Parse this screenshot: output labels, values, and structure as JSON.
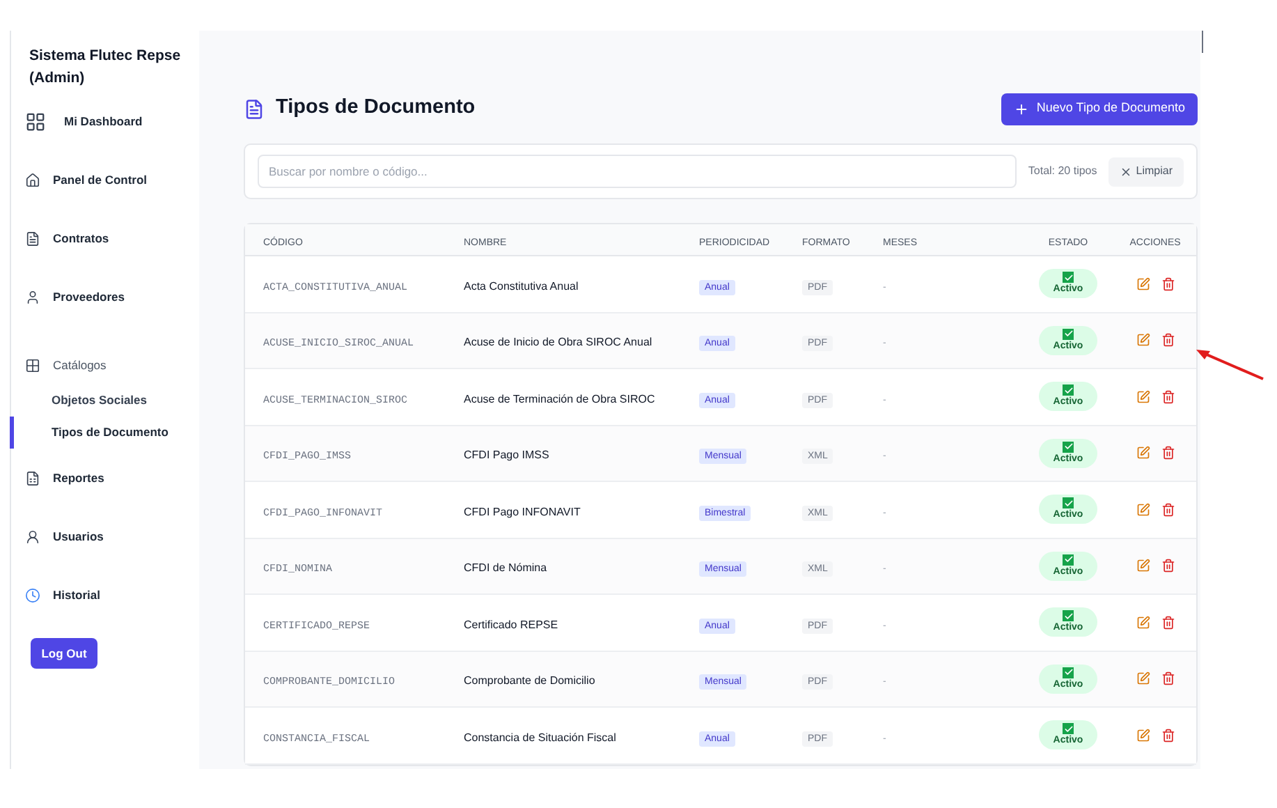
{
  "sidebar": {
    "title": "Sistema Flutec Repse (Admin)",
    "items": [
      {
        "label": "Mi Dashboard",
        "kind": "item",
        "selected": false
      },
      {
        "label": "Panel de Control",
        "kind": "item",
        "selected": false
      },
      {
        "label": "Contratos",
        "kind": "item",
        "selected": false
      },
      {
        "label": "Proveedores",
        "kind": "item",
        "selected": false
      },
      {
        "label": "Catálogos",
        "kind": "group",
        "selected": false
      },
      {
        "label": "Objetos Sociales",
        "kind": "subitem",
        "selected": false
      },
      {
        "label": "Tipos de Documento",
        "kind": "subitem",
        "selected": true
      },
      {
        "label": "Reportes",
        "kind": "item",
        "selected": false
      },
      {
        "label": "Usuarios",
        "kind": "item",
        "selected": false
      },
      {
        "label": "Historial",
        "kind": "item",
        "selected": false
      }
    ],
    "logout": "Log Out"
  },
  "page": {
    "title": "Tipos de Documento",
    "new_button": "Nuevo Tipo de Documento"
  },
  "search": {
    "placeholder": "Buscar por nombre o código...",
    "total": "Total: 20 tipos",
    "clear": "Limpiar"
  },
  "table": {
    "columns": [
      "CÓDIGO",
      "NOMBRE",
      "PERIODICIDAD",
      "FORMATO",
      "MESES",
      "ESTADO",
      "ACCIONES"
    ],
    "rows": [
      {
        "code": "ACTA_CONSTITUTIVA_ANUAL",
        "name": "Acta Constitutiva Anual",
        "period": "Anual",
        "format": "PDF",
        "months": "-",
        "status": "Activo",
        "active": true
      },
      {
        "code": "ACUSE_INICIO_SIROC_ANUAL",
        "name": "Acuse de Inicio de Obra SIROC Anual",
        "period": "Anual",
        "format": "PDF",
        "months": "-",
        "status": "Activo",
        "active": true
      },
      {
        "code": "ACUSE_TERMINACION_SIROC",
        "name": "Acuse de Terminación de Obra SIROC",
        "period": "Anual",
        "format": "PDF",
        "months": "-",
        "status": "Activo",
        "active": true
      },
      {
        "code": "CFDI_PAGO_IMSS",
        "name": "CFDI Pago IMSS",
        "period": "Mensual",
        "format": "XML",
        "months": "-",
        "status": "Activo",
        "active": true
      },
      {
        "code": "CFDI_PAGO_INFONAVIT",
        "name": "CFDI Pago INFONAVIT",
        "period": "Bimestral",
        "format": "XML",
        "months": "-",
        "status": "Activo",
        "active": true
      },
      {
        "code": "CFDI_NOMINA",
        "name": "CFDI de Nómina",
        "period": "Mensual",
        "format": "XML",
        "months": "-",
        "status": "Activo",
        "active": true
      },
      {
        "code": "CERTIFICADO_REPSE",
        "name": "Certificado REPSE",
        "period": "Anual",
        "format": "PDF",
        "months": "-",
        "status": "Activo",
        "active": true
      },
      {
        "code": "COMPROBANTE_DOMICILIO",
        "name": "Comprobante de Domicilio",
        "period": "Mensual",
        "format": "PDF",
        "months": "-",
        "status": "Activo",
        "active": true
      },
      {
        "code": "CONSTANCIA_FISCAL",
        "name": "Constancia de Situación Fiscal",
        "period": "Anual",
        "format": "PDF",
        "months": "-",
        "status": "Activo",
        "active": true
      }
    ]
  }
}
